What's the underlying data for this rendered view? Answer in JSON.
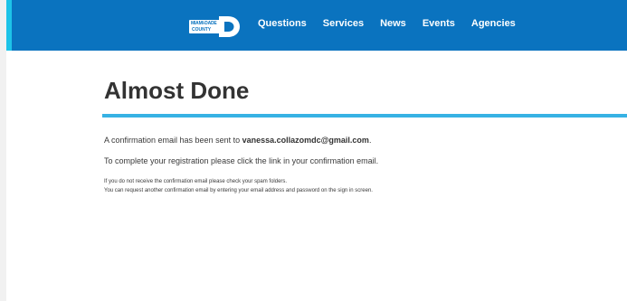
{
  "nav": {
    "logo": {
      "line1": "MIAMI-DADE",
      "line2": "COUNTY"
    },
    "links": [
      "Questions",
      "Services",
      "News",
      "Events",
      "Agencies"
    ]
  },
  "main": {
    "title": "Almost Done",
    "confirmation_prefix": "A confirmation email has been sent to ",
    "email": "vanessa.collazomdc@gmail.com",
    "confirmation_suffix": ".",
    "instruction": "To complete your registration please click the link in your confirmation email.",
    "help_line1": "If you do not receive the confirmation email please check your spam folders.",
    "help_line2": "You can request another confirmation email by entering your email address and password on the sign in screen."
  },
  "colors": {
    "nav_background": "#0a73bf",
    "accent_cyan": "#1dc3e8",
    "divider": "#37b2e4"
  }
}
